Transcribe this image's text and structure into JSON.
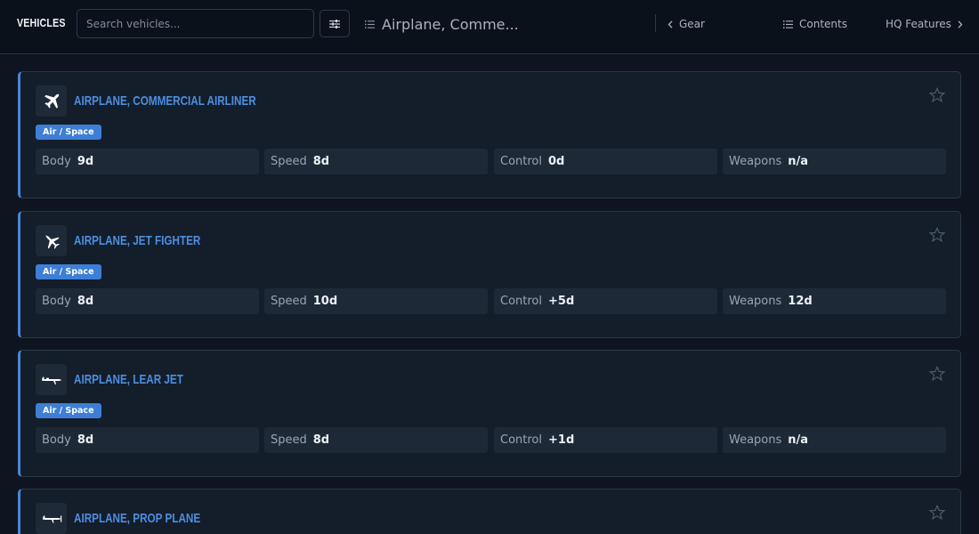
{
  "header": {
    "brand": "VEHICLES",
    "search_placeholder": "Search vehicles...",
    "current": "Airplane, Comme...",
    "prev_label": "Gear",
    "contents_label": "Contents",
    "next_label": "HQ Features"
  },
  "colors": {
    "accent": "#4a86d1",
    "title": "#4d8fe0",
    "tag": "#3d7fd6",
    "background": "#0e1521",
    "card": "#141d2a"
  },
  "vehicles": [
    {
      "title": "Airplane, Commercial Airliner",
      "icon": "airliner-icon",
      "tag": "Air / Space",
      "stats": [
        {
          "label": "Body",
          "value": "9d"
        },
        {
          "label": "Speed",
          "value": "8d"
        },
        {
          "label": "Control",
          "value": "0d"
        },
        {
          "label": "Weapons",
          "value": "n/a"
        }
      ]
    },
    {
      "title": "Airplane, Jet Fighter",
      "icon": "jet-fighter-icon",
      "tag": "Air / Space",
      "stats": [
        {
          "label": "Body",
          "value": "8d"
        },
        {
          "label": "Speed",
          "value": "10d"
        },
        {
          "label": "Control",
          "value": "+5d"
        },
        {
          "label": "Weapons",
          "value": "12d"
        }
      ]
    },
    {
      "title": "Airplane, Lear Jet",
      "icon": "lear-jet-icon",
      "tag": "Air / Space",
      "stats": [
        {
          "label": "Body",
          "value": "8d"
        },
        {
          "label": "Speed",
          "value": "8d"
        },
        {
          "label": "Control",
          "value": "+1d"
        },
        {
          "label": "Weapons",
          "value": "n/a"
        }
      ]
    },
    {
      "title": "Airplane, Prop Plane",
      "icon": "prop-plane-icon"
    }
  ]
}
